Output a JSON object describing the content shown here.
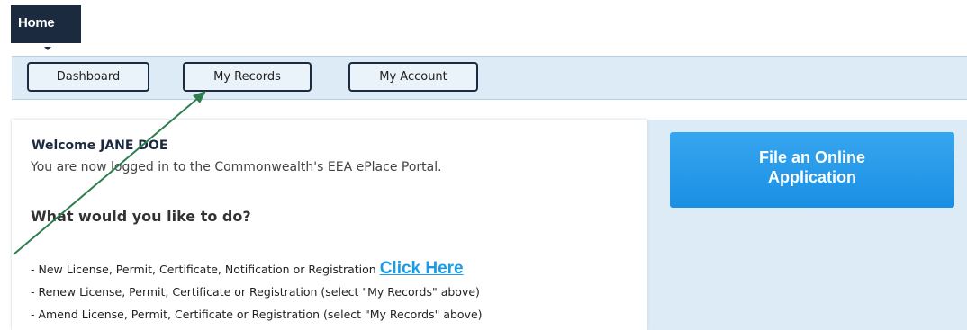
{
  "home_tab": {
    "label": "Home"
  },
  "nav": {
    "dashboard_label": "Dashboard",
    "my_records_label": "My Records",
    "my_account_label": "My Account"
  },
  "welcome": {
    "title": "Welcome JANE DOE",
    "message": "You are now logged in to the Commonwealth's EEA ePlace Portal.",
    "question": "What would you like to do?"
  },
  "options": [
    {
      "text": "- New License, Permit, Certificate, Notification or Registration ",
      "link": "Click Here"
    },
    {
      "text": "- Renew License, Permit, Certificate or Registration (select \"My Records\" above)"
    },
    {
      "text": "- Amend License, Permit, Certificate or Registration (select \"My Records\" above)"
    }
  ],
  "file_button": {
    "line1": "File an Online",
    "line2": "Application"
  },
  "colors": {
    "nav_bg": "#dcebf6",
    "dark": "#1b2a3e",
    "link": "#1a9be8",
    "button_blue": "#1a8fe3",
    "arrow": "#2e7d4f"
  }
}
